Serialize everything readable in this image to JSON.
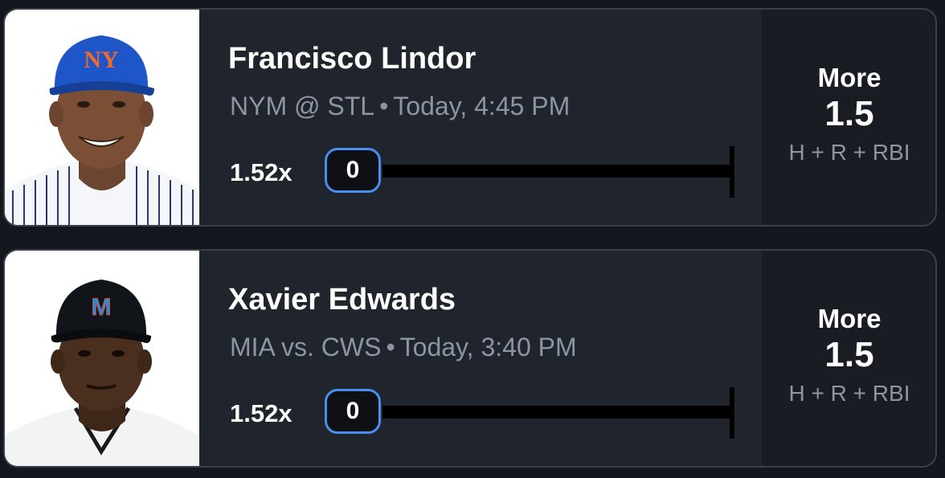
{
  "picks": [
    {
      "player_name": "Francisco Lindor",
      "matchup": "NYM @ STL",
      "separator": "•",
      "game_time": "Today, 4:45 PM",
      "multiplier": "1.52x",
      "current_value": "0",
      "direction": "More",
      "line": "1.5",
      "stat": "H + R + RBI",
      "team_logo_text": "NY",
      "cap_color": "#1f56c7",
      "jersey_style": "pinstripes"
    },
    {
      "player_name": "Xavier Edwards",
      "matchup": "MIA vs. CWS",
      "separator": "•",
      "game_time": "Today, 3:40 PM",
      "multiplier": "1.52x",
      "current_value": "0",
      "direction": "More",
      "line": "1.5",
      "stat": "H + R + RBI",
      "team_logo_text": "M",
      "cap_color": "#111418",
      "jersey_style": "white"
    }
  ],
  "colors": {
    "background": "#14171d",
    "card": "#20252d",
    "card_border": "#3a414c",
    "side_panel": "#191d23",
    "accent_blue": "#4a8ef0",
    "muted_text": "#8d95a2"
  }
}
